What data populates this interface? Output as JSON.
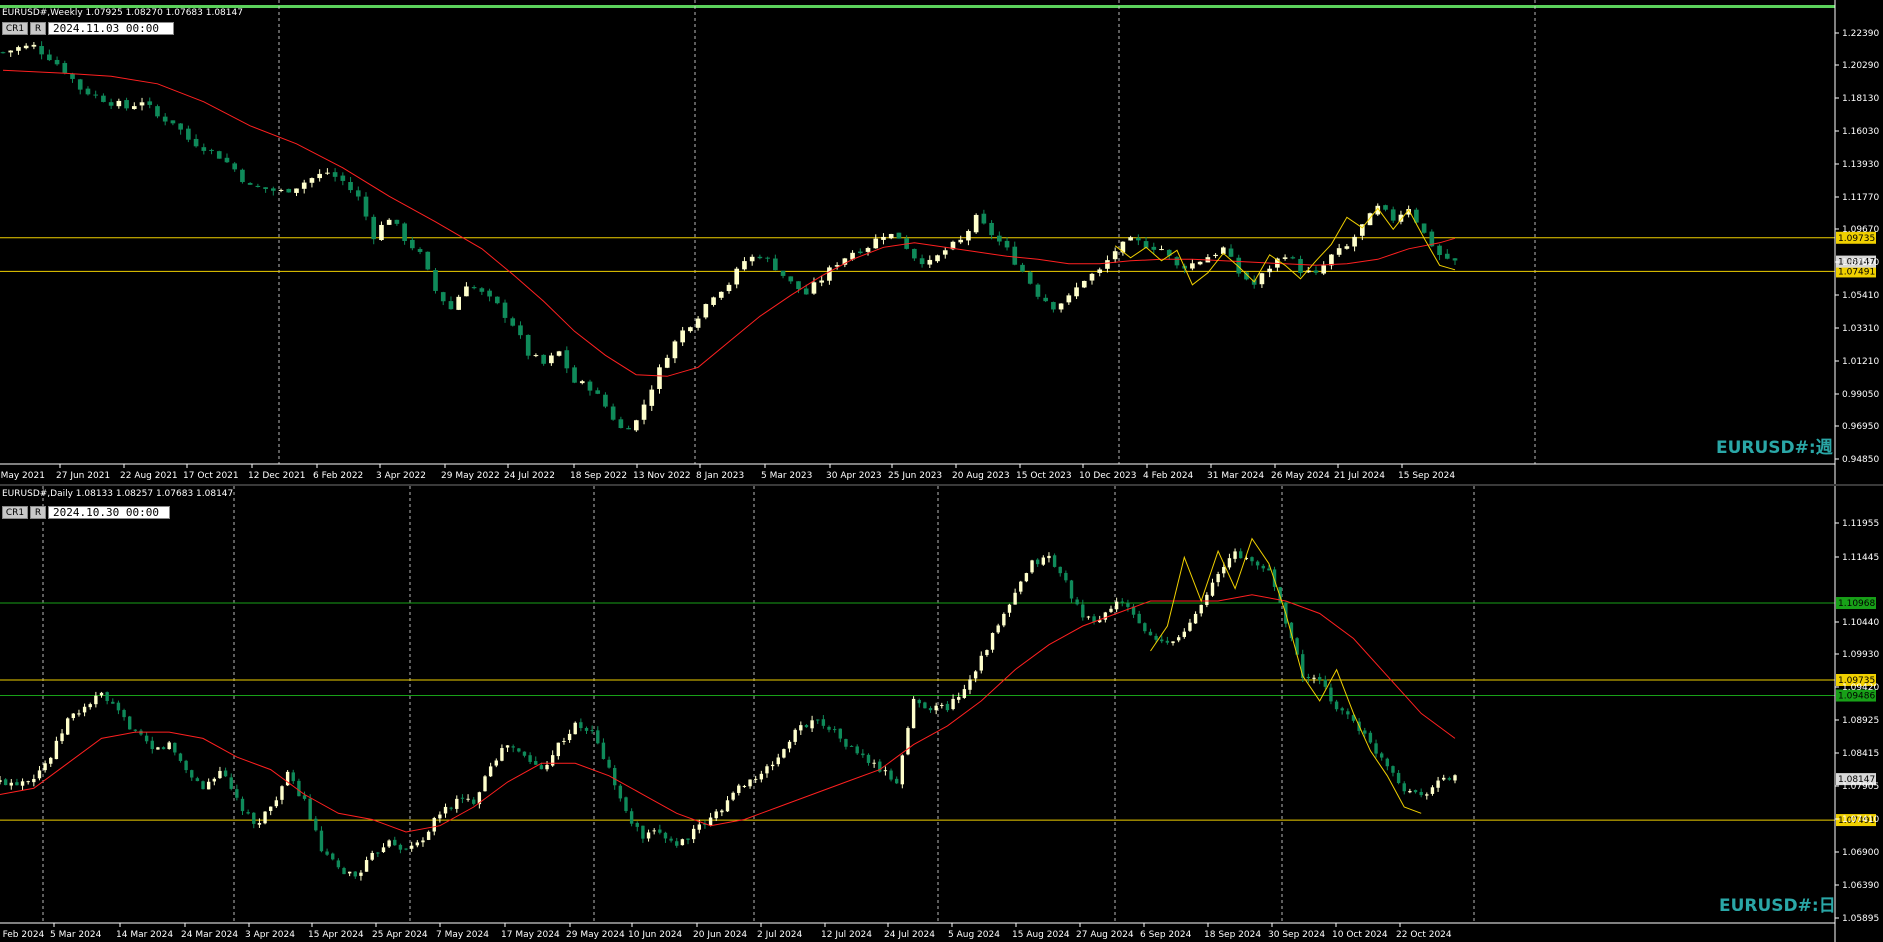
{
  "colors": {
    "bull": "#ffffcc",
    "bear": "#0f8a5a",
    "ma": "#ff2020",
    "level_yellow": "#f0d000",
    "level_green": "#18a018",
    "zigzag": "#f0d000",
    "grid": "#cccccc",
    "watermark": "#2aa7a7"
  },
  "weekly": {
    "title": "EURUSD#,Weekly  1.07925 1.08270 1.07683 1.08147",
    "btn_cr": "CR1",
    "btn_r": "R",
    "date_box": "2024.11.03  00:00",
    "watermark": "EURUSD#:週",
    "price_ticks": [
      "1.22390",
      "1.20290",
      "1.18130",
      "1.16030",
      "1.13930",
      "1.11770",
      "1.09670",
      "1.07510",
      "1.05410",
      "1.03310",
      "1.01210",
      "0.99050",
      "0.96950",
      "0.94850"
    ],
    "level_labels": {
      "upper": "1.09735",
      "current": "1.08147",
      "lower": "1.07491"
    },
    "date_ticks": [
      "2 May 2021",
      "27 Jun 2021",
      "22 Aug 2021",
      "17 Oct 2021",
      "12 Dec 2021",
      "6 Feb 2022",
      "3 Apr 2022",
      "29 May 2022",
      "24 Jul 2022",
      "18 Sep 2022",
      "13 Nov 2022",
      "8 Jan 2023",
      "5 Mar 2023",
      "30 Apr 2023",
      "25 Jun 2023",
      "20 Aug 2023",
      "15 Oct 2023",
      "10 Dec 2023",
      "4 Feb 2024",
      "31 Mar 2024",
      "26 May 2024",
      "21 Jul 2024",
      "15 Sep 2024"
    ]
  },
  "daily": {
    "title": "EURUSD#,Daily  1.08133 1.08257 1.07683 1.08147",
    "btn_cr": "CR1",
    "btn_r": "R",
    "date_box": "2024.10.30  00:00",
    "watermark": "EURUSD#:日",
    "price_ticks": [
      "1.11955",
      "1.11445",
      "1.10440",
      "1.09930",
      "1.09420",
      "1.08925",
      "1.08415",
      "1.07905",
      "1.07410",
      "1.06900",
      "1.06390",
      "1.05895"
    ],
    "level_labels": {
      "green_upper": "1.10968",
      "upper": "1.09735",
      "green_lower": "1.09486",
      "current": "1.08147",
      "lower": "1.07491"
    },
    "date_ticks": [
      "2 Feb 2024",
      "5 Mar 2024",
      "14 Mar 2024",
      "24 Mar 2024",
      "3 Apr 2024",
      "15 Apr 2024",
      "25 Apr 2024",
      "7 May 2024",
      "17 May 2024",
      "29 May 2024",
      "10 Jun 2024",
      "20 Jun 2024",
      "2 Jul 2024",
      "12 Jul 2024",
      "24 Jul 2024",
      "5 Aug 2024",
      "15 Aug 2024",
      "27 Aug 2024",
      "6 Sep 2024",
      "18 Sep 2024",
      "30 Sep 2024",
      "10 Oct 2024",
      "22 Oct 2024"
    ]
  },
  "chart_data": [
    {
      "type": "candlestick",
      "title": "EURUSD#,Weekly",
      "ylim": [
        0.9485,
        1.2339
      ],
      "levels": [
        1.09735,
        1.07491
      ],
      "close_path": [
        [
          0,
          1.221
        ],
        [
          2,
          1.224
        ],
        [
          4,
          1.225
        ],
        [
          6,
          1.218
        ],
        [
          8,
          1.209
        ],
        [
          10,
          1.197
        ],
        [
          12,
          1.192
        ],
        [
          14,
          1.188
        ],
        [
          16,
          1.184
        ],
        [
          18,
          1.189
        ],
        [
          20,
          1.178
        ],
        [
          22,
          1.175
        ],
        [
          24,
          1.163
        ],
        [
          26,
          1.158
        ],
        [
          28,
          1.152
        ],
        [
          30,
          1.143
        ],
        [
          32,
          1.131
        ],
        [
          34,
          1.13
        ],
        [
          36,
          1.128
        ],
        [
          38,
          1.132
        ],
        [
          40,
          1.137
        ],
        [
          42,
          1.141
        ],
        [
          44,
          1.135
        ],
        [
          46,
          1.124
        ],
        [
          48,
          1.099
        ],
        [
          50,
          1.111
        ],
        [
          52,
          1.097
        ],
        [
          54,
          1.086
        ],
        [
          56,
          1.062
        ],
        [
          58,
          1.05
        ],
        [
          60,
          1.067
        ],
        [
          62,
          1.06
        ],
        [
          64,
          1.052
        ],
        [
          66,
          1.04
        ],
        [
          68,
          1.02
        ],
        [
          70,
          1.013
        ],
        [
          72,
          1.021
        ],
        [
          74,
          1.001
        ],
        [
          76,
          0.998
        ],
        [
          78,
          0.985
        ],
        [
          80,
          0.97
        ],
        [
          82,
          0.975
        ],
        [
          84,
          0.998
        ],
        [
          86,
          1.02
        ],
        [
          88,
          1.035
        ],
        [
          90,
          1.046
        ],
        [
          92,
          1.06
        ],
        [
          94,
          1.067
        ],
        [
          96,
          1.082
        ],
        [
          98,
          1.086
        ],
        [
          100,
          1.078
        ],
        [
          102,
          1.067
        ],
        [
          104,
          1.06
        ],
        [
          106,
          1.07
        ],
        [
          108,
          1.081
        ],
        [
          110,
          1.088
        ],
        [
          112,
          1.092
        ],
        [
          114,
          1.1
        ],
        [
          116,
          1.098
        ],
        [
          118,
          1.085
        ],
        [
          120,
          1.08
        ],
        [
          122,
          1.089
        ],
        [
          124,
          1.095
        ],
        [
          126,
          1.11
        ],
        [
          128,
          1.1
        ],
        [
          130,
          1.089
        ],
        [
          132,
          1.075
        ],
        [
          134,
          1.06
        ],
        [
          136,
          1.052
        ],
        [
          138,
          1.057
        ],
        [
          140,
          1.07
        ],
        [
          142,
          1.075
        ],
        [
          144,
          1.089
        ],
        [
          146,
          1.095
        ],
        [
          148,
          1.093
        ],
        [
          150,
          1.09
        ],
        [
          152,
          1.078
        ],
        [
          154,
          1.08
        ],
        [
          156,
          1.085
        ],
        [
          158,
          1.09
        ],
        [
          160,
          1.074
        ],
        [
          162,
          1.066
        ],
        [
          164,
          1.078
        ],
        [
          166,
          1.087
        ],
        [
          168,
          1.076
        ],
        [
          170,
          1.072
        ],
        [
          172,
          1.085
        ],
        [
          174,
          1.091
        ],
        [
          176,
          1.105
        ],
        [
          178,
          1.117
        ],
        [
          180,
          1.11
        ],
        [
          182,
          1.118
        ],
        [
          184,
          1.1
        ],
        [
          186,
          1.086
        ],
        [
          188,
          1.081
        ]
      ],
      "ma_path": [
        [
          0,
          1.209
        ],
        [
          8,
          1.207
        ],
        [
          14,
          1.205
        ],
        [
          20,
          1.2
        ],
        [
          26,
          1.188
        ],
        [
          32,
          1.172
        ],
        [
          38,
          1.16
        ],
        [
          44,
          1.144
        ],
        [
          50,
          1.125
        ],
        [
          56,
          1.108
        ],
        [
          62,
          1.09
        ],
        [
          66,
          1.073
        ],
        [
          70,
          1.055
        ],
        [
          74,
          1.035
        ],
        [
          78,
          1.019
        ],
        [
          82,
          1.006
        ],
        [
          86,
          1.005
        ],
        [
          90,
          1.011
        ],
        [
          94,
          1.028
        ],
        [
          98,
          1.045
        ],
        [
          102,
          1.059
        ],
        [
          106,
          1.072
        ],
        [
          110,
          1.083
        ],
        [
          114,
          1.091
        ],
        [
          118,
          1.094
        ],
        [
          122,
          1.091
        ],
        [
          126,
          1.088
        ],
        [
          130,
          1.085
        ],
        [
          134,
          1.083
        ],
        [
          138,
          1.08
        ],
        [
          142,
          1.08
        ],
        [
          146,
          1.082
        ],
        [
          150,
          1.083
        ],
        [
          154,
          1.083
        ],
        [
          158,
          1.082
        ],
        [
          162,
          1.081
        ],
        [
          166,
          1.08
        ],
        [
          170,
          1.079
        ],
        [
          174,
          1.08
        ],
        [
          178,
          1.083
        ],
        [
          182,
          1.09
        ],
        [
          186,
          1.094
        ],
        [
          188,
          1.097
        ]
      ],
      "zigzag": [
        [
          144,
          1.092
        ],
        [
          146,
          1.084
        ],
        [
          148,
          1.091
        ],
        [
          150,
          1.082
        ],
        [
          152,
          1.089
        ],
        [
          154,
          1.066
        ],
        [
          156,
          1.074
        ],
        [
          158,
          1.087
        ],
        [
          160,
          1.078
        ],
        [
          162,
          1.068
        ],
        [
          164,
          1.086
        ],
        [
          166,
          1.079
        ],
        [
          168,
          1.07
        ],
        [
          170,
          1.082
        ],
        [
          172,
          1.093
        ],
        [
          174,
          1.111
        ],
        [
          176,
          1.104
        ],
        [
          178,
          1.117
        ],
        [
          180,
          1.103
        ],
        [
          182,
          1.116
        ],
        [
          184,
          1.097
        ],
        [
          186,
          1.079
        ],
        [
          188,
          1.076
        ]
      ],
      "last": 1.08147
    },
    {
      "type": "candlestick",
      "title": "EURUSD#,Daily",
      "ylim": [
        1.0589,
        1.1225
      ],
      "levels": [
        1.10968,
        1.09735,
        1.09486,
        1.07491
      ],
      "close_path": [
        [
          0,
          1.081
        ],
        [
          3,
          1.081
        ],
        [
          6,
          1.082
        ],
        [
          9,
          1.085
        ],
        [
          12,
          1.091
        ],
        [
          15,
          1.093
        ],
        [
          18,
          1.095
        ],
        [
          21,
          1.092
        ],
        [
          24,
          1.089
        ],
        [
          27,
          1.086
        ],
        [
          30,
          1.087
        ],
        [
          33,
          1.083
        ],
        [
          36,
          1.08
        ],
        [
          39,
          1.083
        ],
        [
          42,
          1.078
        ],
        [
          45,
          1.074
        ],
        [
          48,
          1.077
        ],
        [
          51,
          1.082
        ],
        [
          54,
          1.078
        ],
        [
          57,
          1.07
        ],
        [
          60,
          1.067
        ],
        [
          63,
          1.066
        ],
        [
          66,
          1.069
        ],
        [
          69,
          1.072
        ],
        [
          72,
          1.07
        ],
        [
          75,
          1.072
        ],
        [
          78,
          1.076
        ],
        [
          81,
          1.078
        ],
        [
          84,
          1.078
        ],
        [
          87,
          1.084
        ],
        [
          90,
          1.087
        ],
        [
          93,
          1.085
        ],
        [
          96,
          1.083
        ],
        [
          99,
          1.087
        ],
        [
          102,
          1.09
        ],
        [
          105,
          1.089
        ],
        [
          108,
          1.083
        ],
        [
          111,
          1.076
        ],
        [
          114,
          1.072
        ],
        [
          117,
          1.073
        ],
        [
          120,
          1.071
        ],
        [
          123,
          1.073
        ],
        [
          126,
          1.075
        ],
        [
          129,
          1.078
        ],
        [
          132,
          1.081
        ],
        [
          135,
          1.082
        ],
        [
          138,
          1.085
        ],
        [
          141,
          1.089
        ],
        [
          144,
          1.091
        ],
        [
          147,
          1.09
        ],
        [
          150,
          1.087
        ],
        [
          153,
          1.085
        ],
        [
          156,
          1.083
        ],
        [
          159,
          1.081
        ],
        [
          162,
          1.094
        ],
        [
          165,
          1.093
        ],
        [
          168,
          1.093
        ],
        [
          171,
          1.096
        ],
        [
          174,
          1.101
        ],
        [
          177,
          1.106
        ],
        [
          180,
          1.111
        ],
        [
          183,
          1.116
        ],
        [
          186,
          1.117
        ],
        [
          189,
          1.113
        ],
        [
          192,
          1.107
        ],
        [
          195,
          1.107
        ],
        [
          198,
          1.11
        ],
        [
          201,
          1.108
        ],
        [
          204,
          1.104
        ],
        [
          207,
          1.103
        ],
        [
          210,
          1.105
        ],
        [
          213,
          1.11
        ],
        [
          216,
          1.114
        ],
        [
          219,
          1.118
        ],
        [
          222,
          1.116
        ],
        [
          225,
          1.115
        ],
        [
          228,
          1.107
        ],
        [
          231,
          1.098
        ],
        [
          234,
          1.097
        ],
        [
          237,
          1.093
        ],
        [
          240,
          1.091
        ],
        [
          243,
          1.087
        ],
        [
          246,
          1.084
        ],
        [
          249,
          1.08
        ],
        [
          252,
          1.079
        ],
        [
          255,
          1.081
        ],
        [
          258,
          1.082
        ]
      ],
      "ma_path": [
        [
          0,
          1.079
        ],
        [
          6,
          1.08
        ],
        [
          12,
          1.084
        ],
        [
          18,
          1.088
        ],
        [
          24,
          1.089
        ],
        [
          30,
          1.089
        ],
        [
          36,
          1.088
        ],
        [
          42,
          1.085
        ],
        [
          48,
          1.083
        ],
        [
          54,
          1.079
        ],
        [
          60,
          1.076
        ],
        [
          66,
          1.075
        ],
        [
          72,
          1.073
        ],
        [
          78,
          1.074
        ],
        [
          84,
          1.077
        ],
        [
          90,
          1.081
        ],
        [
          96,
          1.084
        ],
        [
          102,
          1.084
        ],
        [
          108,
          1.082
        ],
        [
          114,
          1.079
        ],
        [
          120,
          1.076
        ],
        [
          126,
          1.074
        ],
        [
          132,
          1.075
        ],
        [
          138,
          1.077
        ],
        [
          144,
          1.079
        ],
        [
          150,
          1.081
        ],
        [
          156,
          1.083
        ],
        [
          162,
          1.087
        ],
        [
          168,
          1.09
        ],
        [
          174,
          1.094
        ],
        [
          180,
          1.099
        ],
        [
          186,
          1.103
        ],
        [
          192,
          1.106
        ],
        [
          198,
          1.108
        ],
        [
          204,
          1.11
        ],
        [
          210,
          1.11
        ],
        [
          216,
          1.11
        ],
        [
          222,
          1.111
        ],
        [
          228,
          1.11
        ],
        [
          234,
          1.108
        ],
        [
          240,
          1.104
        ],
        [
          246,
          1.098
        ],
        [
          252,
          1.092
        ],
        [
          258,
          1.088
        ]
      ],
      "zigzag": [
        [
          204,
          1.102
        ],
        [
          207,
          1.106
        ],
        [
          210,
          1.117
        ],
        [
          213,
          1.11
        ],
        [
          216,
          1.118
        ],
        [
          219,
          1.112
        ],
        [
          222,
          1.12
        ],
        [
          225,
          1.116
        ],
        [
          228,
          1.108
        ],
        [
          231,
          1.098
        ],
        [
          234,
          1.094
        ],
        [
          237,
          1.099
        ],
        [
          240,
          1.092
        ],
        [
          243,
          1.086
        ],
        [
          246,
          1.082
        ],
        [
          249,
          1.077
        ],
        [
          252,
          1.076
        ]
      ],
      "last": 1.08147
    }
  ]
}
